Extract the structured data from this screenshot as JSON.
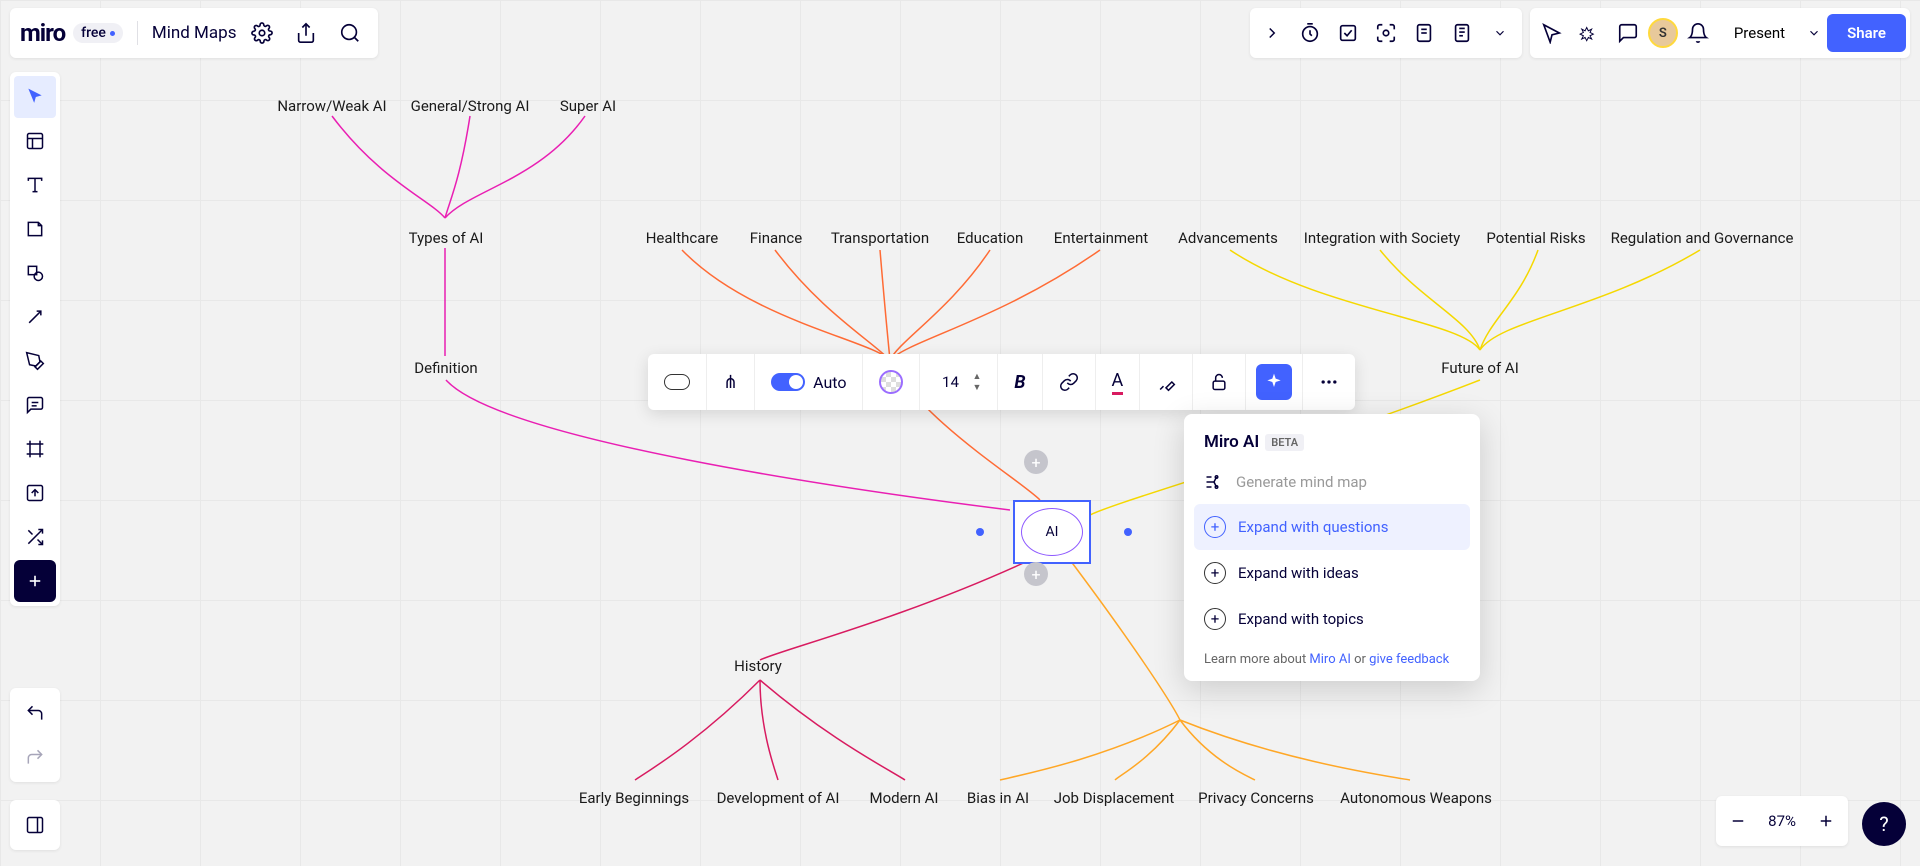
{
  "app": {
    "logo": "miro",
    "plan": "free",
    "board_name": "Mind Maps"
  },
  "top_right": {
    "present": "Present",
    "share": "Share",
    "avatar_initial": "S"
  },
  "context_bar": {
    "auto_label": "Auto",
    "font_size": "14"
  },
  "ai_popup": {
    "title": "Miro AI",
    "badge": "BETA",
    "generate": "Generate mind map",
    "questions": "Expand with questions",
    "ideas": "Expand with ideas",
    "topics": "Expand with topics",
    "footer_prefix": "Learn more about ",
    "footer_link1": "Miro AI",
    "footer_mid": " or ",
    "footer_link2": "give feedback"
  },
  "zoom": {
    "value": "87%"
  },
  "mindmap": {
    "center": "AI",
    "types": "Types of AI",
    "types_children": {
      "narrow": "Narrow/Weak AI",
      "general": "General/Strong AI",
      "super": "Super AI"
    },
    "definition": "Definition",
    "apps_children": {
      "health": "Healthcare",
      "finance": "Finance",
      "transport": "Transportation",
      "edu": "Education",
      "ent": "Entertainment"
    },
    "future": "Future of AI",
    "future_children": {
      "adv": "Advancements",
      "integ": "Integration with Society",
      "risks": "Potential Risks",
      "reg": "Regulation and Governance"
    },
    "history": "History",
    "history_children": {
      "early": "Early Beginnings",
      "dev": "Development of AI",
      "modern": "Modern AI"
    },
    "ethics_children": {
      "bias": "Bias in AI",
      "job": "Job Displacement",
      "privacy": "Privacy Concerns",
      "weapons": "Autonomous Weapons"
    }
  }
}
